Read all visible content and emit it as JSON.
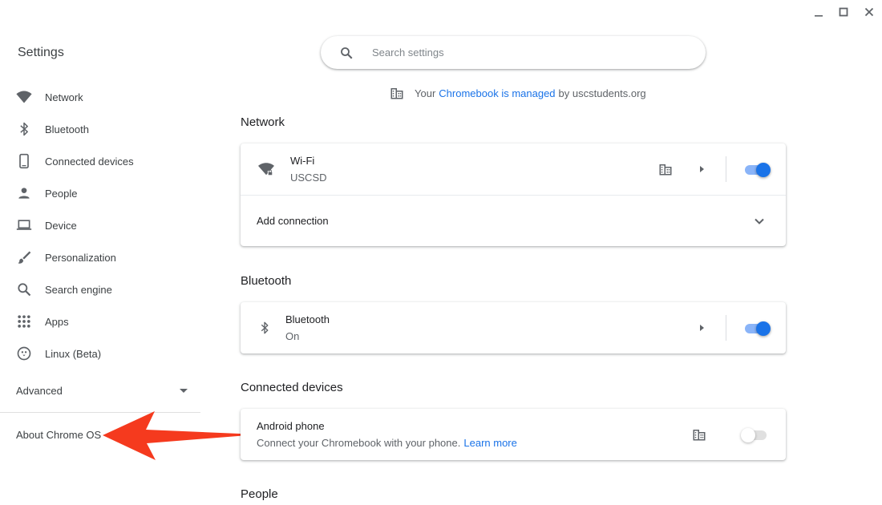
{
  "window": {
    "minimize_icon": "minimize-icon",
    "maximize_icon": "maximize-icon",
    "close_icon": "close-icon"
  },
  "sidebar": {
    "title": "Settings",
    "items": [
      {
        "label": "Network",
        "icon": "wifi-icon"
      },
      {
        "label": "Bluetooth",
        "icon": "bluetooth-icon"
      },
      {
        "label": "Connected devices",
        "icon": "phone-icon"
      },
      {
        "label": "People",
        "icon": "person-icon"
      },
      {
        "label": "Device",
        "icon": "laptop-icon"
      },
      {
        "label": "Personalization",
        "icon": "brush-icon"
      },
      {
        "label": "Search engine",
        "icon": "search-icon"
      },
      {
        "label": "Apps",
        "icon": "apps-grid-icon"
      },
      {
        "label": "Linux (Beta)",
        "icon": "penguin-icon"
      }
    ],
    "advanced_label": "Advanced",
    "about_label": "About Chrome OS"
  },
  "search": {
    "placeholder": "Search settings",
    "value": ""
  },
  "managed_notice": {
    "prefix": "Your",
    "link": "Chromebook is managed",
    "suffix": "by uscstudents.org"
  },
  "sections": {
    "network": {
      "title": "Network",
      "wifi_label": "Wi-Fi",
      "wifi_network": "USCSD",
      "wifi_enabled": true,
      "add_connection_label": "Add connection"
    },
    "bluetooth": {
      "title": "Bluetooth",
      "label": "Bluetooth",
      "status": "On",
      "enabled": true
    },
    "connected_devices": {
      "title": "Connected devices",
      "label": "Android phone",
      "description": "Connect your Chromebook with your phone.",
      "learn_more": "Learn more",
      "enabled": false
    },
    "people": {
      "title": "People"
    }
  },
  "colors": {
    "accent": "#1a73e8",
    "annotation_arrow": "#f53a1e"
  }
}
